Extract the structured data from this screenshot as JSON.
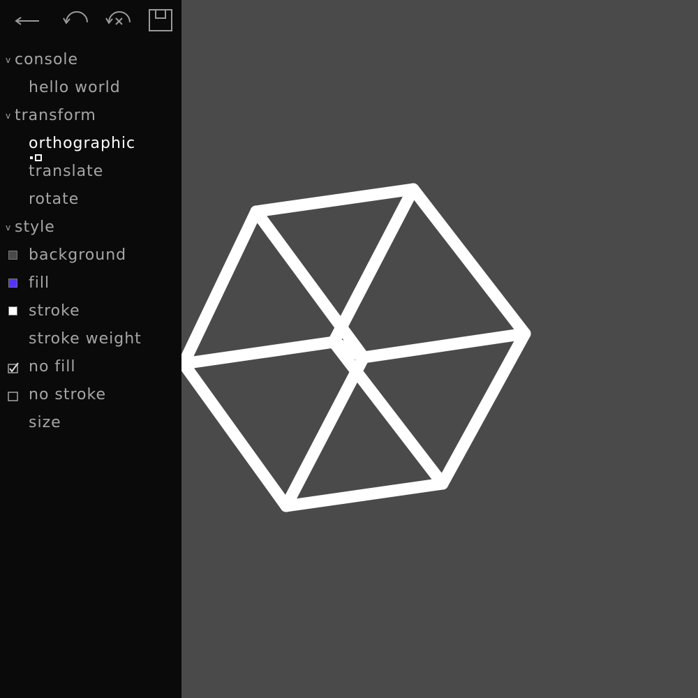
{
  "toolbar": {
    "buttons": [
      {
        "name": "back-button",
        "icon": "arrow-left-icon"
      },
      {
        "name": "undo-button",
        "icon": "undo-icon"
      },
      {
        "name": "clear-button",
        "icon": "undo-close-icon"
      },
      {
        "name": "save-button",
        "icon": "save-icon"
      }
    ]
  },
  "sidebar": {
    "console": {
      "label": "console",
      "items": [
        "hello world"
      ]
    },
    "transform": {
      "label": "transform",
      "items": [
        "orthographic",
        "translate",
        "rotate"
      ],
      "active": "orthographic"
    },
    "style": {
      "label": "style",
      "items": [
        {
          "label": "background",
          "swatch": "#4a4a4a"
        },
        {
          "label": "fill",
          "swatch": "#5533ff"
        },
        {
          "label": "stroke",
          "swatch": "#ffffff"
        },
        {
          "label": "stroke weight"
        },
        {
          "label": "no fill",
          "checked": true
        },
        {
          "label": "no stroke",
          "checked": false
        },
        {
          "label": "size"
        }
      ]
    }
  },
  "canvas": {
    "background": "#4a4a4a",
    "stroke": "#ffffff",
    "shape": "wireframe-cube"
  }
}
